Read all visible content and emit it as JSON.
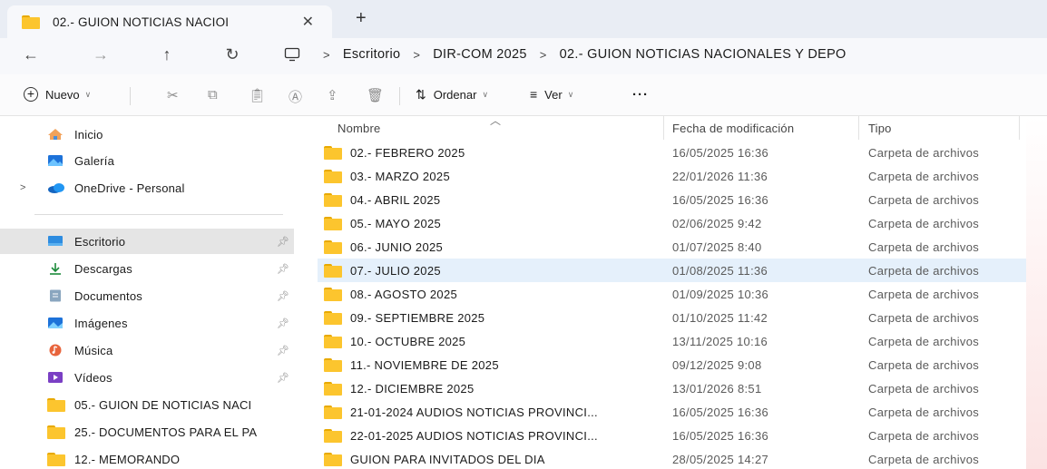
{
  "window": {
    "tab_title": "02.- GUION NOTICIAS NACIOI",
    "tab_close": "✕",
    "new_tab": "+"
  },
  "nav": {
    "back": "←",
    "forward": "→",
    "up": "↑",
    "refresh": "↻",
    "breadcrumb": [
      "Escritorio",
      "DIR-COM 2025",
      "02.- GUION NOTICIAS NACIONALES Y DEPO"
    ],
    "separator": ">"
  },
  "commands": {
    "new_label": "Nuevo",
    "sort_label": "Ordenar",
    "view_label": "Ver",
    "more_label": "···"
  },
  "sidebar": {
    "items": [
      {
        "label": "Inicio",
        "icon": "home-icon"
      },
      {
        "label": "Galería",
        "icon": "gallery-icon"
      },
      {
        "label": "OneDrive - Personal",
        "icon": "onedrive-icon"
      },
      {
        "label": "Escritorio",
        "icon": "desktop-icon"
      },
      {
        "label": "Descargas",
        "icon": "download-icon"
      },
      {
        "label": "Documentos",
        "icon": "documents-icon"
      },
      {
        "label": "Imágenes",
        "icon": "pictures-icon"
      },
      {
        "label": "Música",
        "icon": "music-icon"
      },
      {
        "label": "Vídeos",
        "icon": "videos-icon"
      },
      {
        "label": "05.- GUION DE NOTICIAS NACI",
        "icon": "folder-icon"
      },
      {
        "label": "25.- DOCUMENTOS PARA EL PA",
        "icon": "folder-icon"
      },
      {
        "label": "12.- MEMORANDO",
        "icon": "folder-icon"
      }
    ]
  },
  "columns": {
    "name": "Nombre",
    "date": "Fecha de modificación",
    "type": "Tipo"
  },
  "files": [
    {
      "name": "02.- FEBRERO 2025",
      "date": "16/05/2025 16:36",
      "type": "Carpeta de archivos"
    },
    {
      "name": "03.- MARZO 2025",
      "date": "22/01/2026 11:36",
      "type": "Carpeta de archivos"
    },
    {
      "name": "04.- ABRIL 2025",
      "date": "16/05/2025 16:36",
      "type": "Carpeta de archivos"
    },
    {
      "name": "05.- MAYO 2025",
      "date": "02/06/2025 9:42",
      "type": "Carpeta de archivos"
    },
    {
      "name": "06.- JUNIO 2025",
      "date": "01/07/2025 8:40",
      "type": "Carpeta de archivos"
    },
    {
      "name": "07.- JULIO 2025",
      "date": "01/08/2025 11:36",
      "type": "Carpeta de archivos"
    },
    {
      "name": "08.- AGOSTO 2025",
      "date": "01/09/2025 10:36",
      "type": "Carpeta de archivos"
    },
    {
      "name": "09.- SEPTIEMBRE 2025",
      "date": "01/10/2025 11:42",
      "type": "Carpeta de archivos"
    },
    {
      "name": "10.- OCTUBRE 2025",
      "date": "13/11/2025 10:16",
      "type": "Carpeta de archivos"
    },
    {
      "name": "11.- NOVIEMBRE DE 2025",
      "date": "09/12/2025 9:08",
      "type": "Carpeta de archivos"
    },
    {
      "name": "12.- DICIEMBRE 2025",
      "date": "13/01/2026 8:51",
      "type": "Carpeta de archivos"
    },
    {
      "name": "21-01-2024 AUDIOS NOTICIAS PROVINCI...",
      "date": "16/05/2025 16:36",
      "type": "Carpeta de archivos"
    },
    {
      "name": "22-01-2025 AUDIOS NOTICIAS PROVINCI...",
      "date": "16/05/2025 16:36",
      "type": "Carpeta de archivos"
    },
    {
      "name": "GUION PARA INVITADOS DEL DIA",
      "date": "28/05/2025 14:27",
      "type": "Carpeta de archivos"
    }
  ],
  "colors": {
    "folder": "#fcc52e",
    "selected_row": "#e5f0fb",
    "selected_sidebar": "#e5e5e5"
  }
}
